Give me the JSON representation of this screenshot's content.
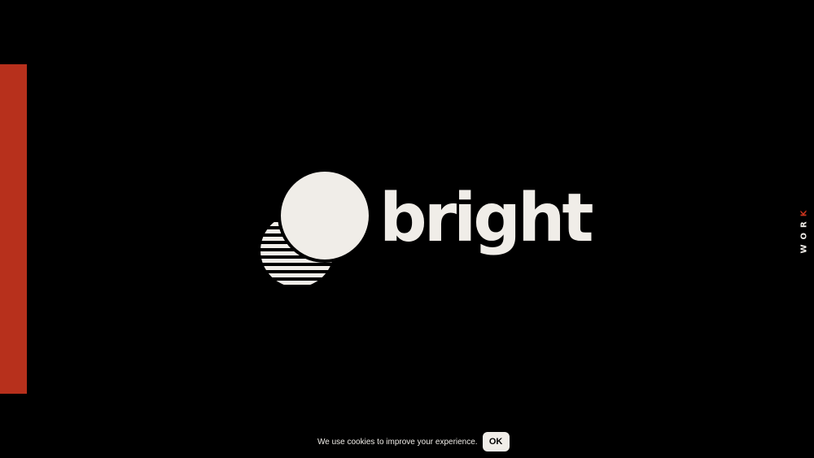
{
  "brand": {
    "name": "bright",
    "logo_icon": "overlapping-sun-icon"
  },
  "side_nav": {
    "label_main": "WOR",
    "label_accent": "K"
  },
  "cookie_banner": {
    "message": "We use cookies to improve your experience.",
    "ok_label": "OK"
  },
  "colors": {
    "background": "#000000",
    "accent": "#b7301c",
    "cream": "#f0ede8"
  }
}
